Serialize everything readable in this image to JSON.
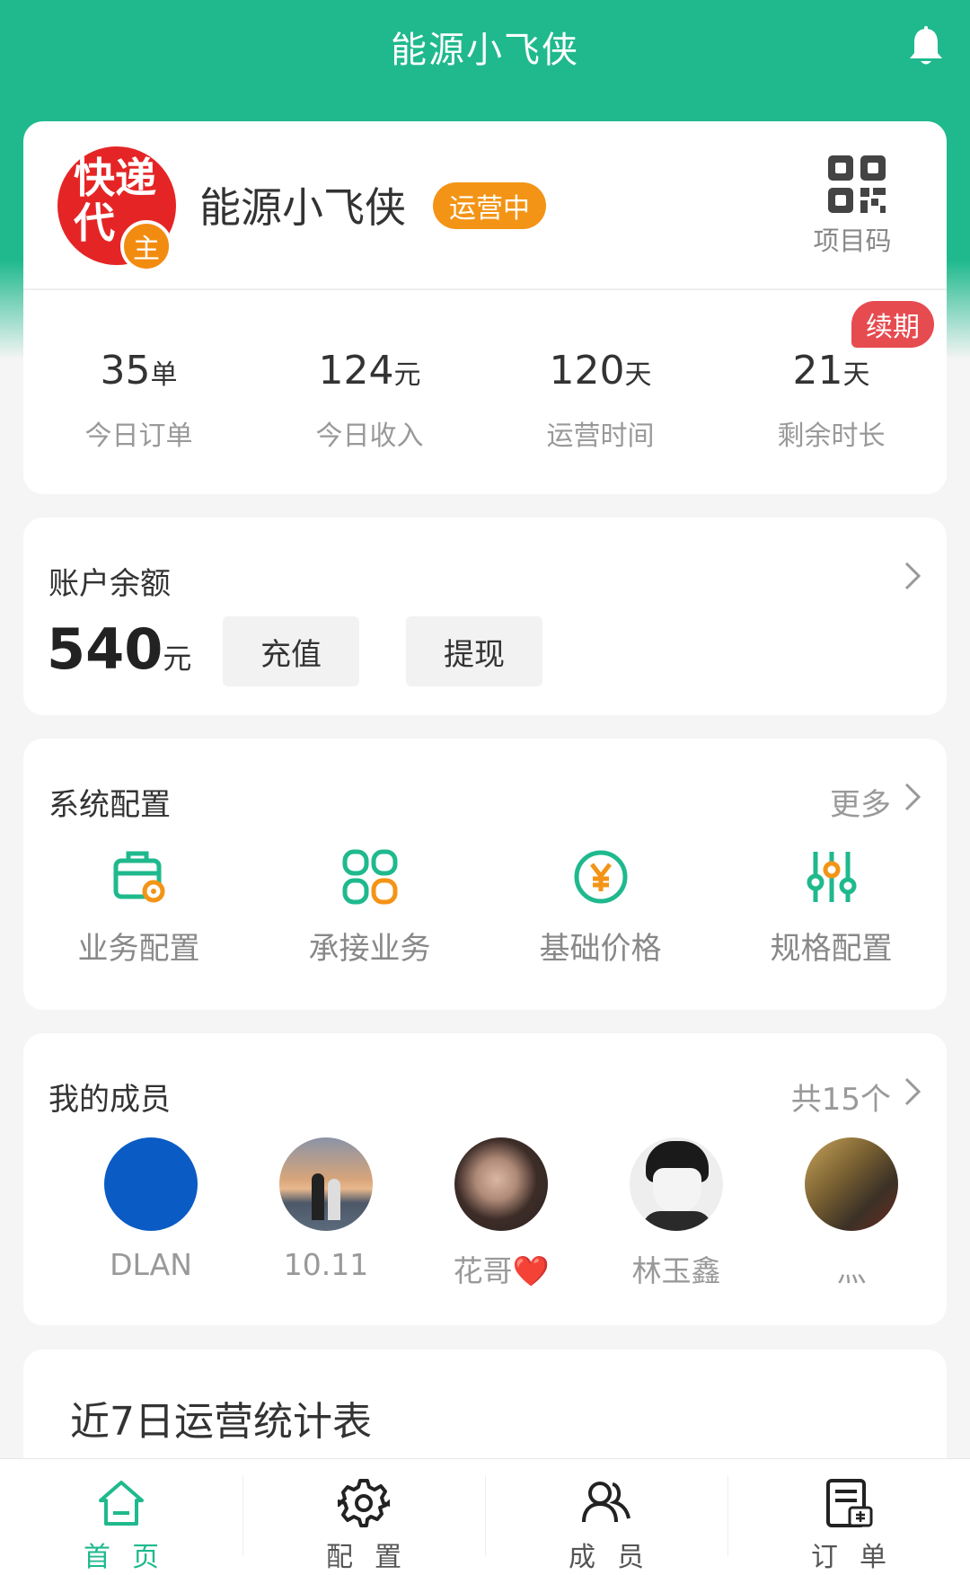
{
  "header": {
    "title": "能源小飞侠",
    "bell_icon": "bell-icon"
  },
  "profile": {
    "logo_text_line1": "快递",
    "logo_text_line2": "代",
    "logo_badge": "主",
    "name": "能源小飞侠",
    "status": "运营中",
    "qr_label": "项目码",
    "renew_badge": "续期",
    "stats": [
      {
        "value": "35",
        "unit": "单",
        "label": "今日订单"
      },
      {
        "value": "124",
        "unit": "元",
        "label": "今日收入"
      },
      {
        "value": "120",
        "unit": "天",
        "label": "运营时间"
      },
      {
        "value": "21",
        "unit": "天",
        "label": "剩余时长"
      }
    ]
  },
  "balance": {
    "title": "账户余额",
    "amount": "540",
    "unit": "元",
    "recharge_label": "充值",
    "withdraw_label": "提现"
  },
  "config": {
    "title": "系统配置",
    "more_label": "更多",
    "items": [
      {
        "label": "业务配置",
        "icon": "briefcase-settings-icon"
      },
      {
        "label": "承接业务",
        "icon": "apps-grid-icon"
      },
      {
        "label": "基础价格",
        "icon": "yen-coin-icon"
      },
      {
        "label": "规格配置",
        "icon": "sliders-icon"
      }
    ]
  },
  "members": {
    "title": "我的成员",
    "count_label": "共15个",
    "list": [
      {
        "name": "DLAN"
      },
      {
        "name": "10.11"
      },
      {
        "name": "花哥❤️"
      },
      {
        "name": "林玉鑫"
      },
      {
        "name": "灬"
      }
    ]
  },
  "weekly": {
    "title": "近7日运营统计表"
  },
  "tabbar": {
    "tabs": [
      {
        "label": "首页",
        "icon": "home-icon"
      },
      {
        "label": "配置",
        "icon": "gear-icon"
      },
      {
        "label": "成员",
        "icon": "users-icon"
      },
      {
        "label": "订单",
        "icon": "order-receipt-icon"
      }
    ]
  },
  "colors": {
    "brand": "#1fb98d",
    "status_orange": "#f39416",
    "renew_red": "#e64b50",
    "logo_red": "#e52525"
  }
}
